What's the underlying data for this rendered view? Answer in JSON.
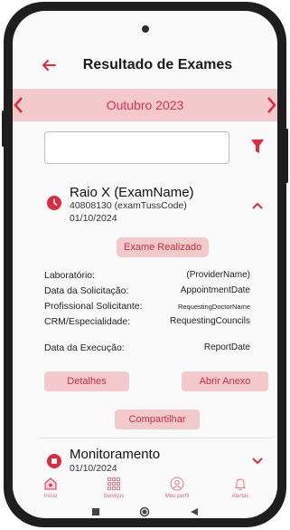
{
  "header": {
    "title": "Resultado de Exames"
  },
  "month_selector": {
    "label": "Outubro 2023"
  },
  "search": {
    "value": "",
    "placeholder": ""
  },
  "exams": [
    {
      "name": "Raio X  (ExamName)",
      "code": "40808130 (examTussCode)",
      "date": "01/10/2024",
      "status": "Exame Realizado",
      "details": [
        {
          "label": "Laboratório:",
          "value": "(ProviderName)"
        },
        {
          "label": "Data da Solicitação:",
          "value": "AppointmentDate"
        },
        {
          "label": "Profissional Solicitante:",
          "value": "RequestingDoctorName"
        },
        {
          "label": "CRM/Especialidade:",
          "value": "RequestingCouncils"
        },
        {
          "label": "Data da Execução:",
          "value": "ReportDate"
        }
      ],
      "actions": {
        "details": "Detalhes",
        "open_attachment": "Abrir Anexo",
        "share": "Compartilhar"
      }
    },
    {
      "name": "Monitoramento",
      "date": "01/10/2024"
    }
  ],
  "nav": {
    "items": [
      {
        "label": "Início",
        "icon": "home-icon"
      },
      {
        "label": "Serviços",
        "icon": "grid-icon"
      },
      {
        "label": "Meu perfil",
        "icon": "profile-icon"
      },
      {
        "label": "Alertas",
        "icon": "bell-icon"
      }
    ]
  },
  "colors": {
    "accent": "#e02a3f",
    "accent_light": "#f3c9cc",
    "accent_text": "#c62f43"
  }
}
